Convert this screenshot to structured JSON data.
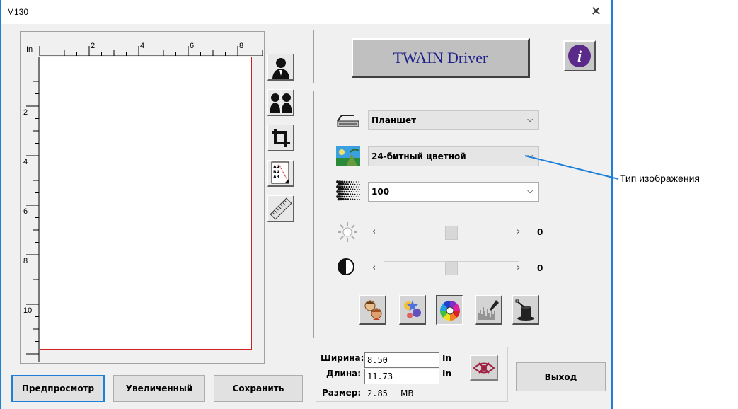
{
  "window": {
    "title": "M130",
    "close_glyph": "✕"
  },
  "ruler": {
    "unit": "In",
    "top_labels": [
      "2",
      "4",
      "6",
      "8"
    ],
    "left_labels": [
      "2",
      "4",
      "6",
      "8",
      "10"
    ]
  },
  "tools": [
    {
      "name": "auto-crop-icon"
    },
    {
      "name": "multi-crop-icon"
    },
    {
      "name": "crop-icon"
    },
    {
      "name": "paper-size-icon",
      "text": "A4\nB4\nA3"
    },
    {
      "name": "ruler-icon"
    }
  ],
  "buttons": {
    "preview": "Предпросмотр",
    "zoom": "Увеличенный",
    "save": "Сохранить",
    "exit": "Выход",
    "twain": "TWAIN Driver",
    "info": "i"
  },
  "scan_source": {
    "value": "Планшет"
  },
  "image_type": {
    "value": "24-битный цветной"
  },
  "resolution": {
    "value": "100"
  },
  "brightness": {
    "value": "0",
    "level": 0.5
  },
  "contrast": {
    "value": "0",
    "level": 0.5
  },
  "mode_buttons": [
    {
      "name": "descreen-icon"
    },
    {
      "name": "filter-icon"
    },
    {
      "name": "color-adjust-icon"
    },
    {
      "name": "histogram-icon"
    },
    {
      "name": "magic-hat-icon"
    }
  ],
  "size": {
    "width_label": "Ширина:",
    "width_value": "8.50",
    "width_unit": "In",
    "length_label": "Длина:",
    "length_value": "11.73",
    "length_unit": "In",
    "filesize_label": "Размер:",
    "filesize_value": "2.85",
    "filesize_unit": "MB"
  },
  "callout": {
    "text": "Тип изображения"
  },
  "colors": {
    "accent": "#1c7fd8",
    "scan_border": "#d02020",
    "twain_text": "#20208a",
    "info_purple": "#5a2a8a"
  }
}
